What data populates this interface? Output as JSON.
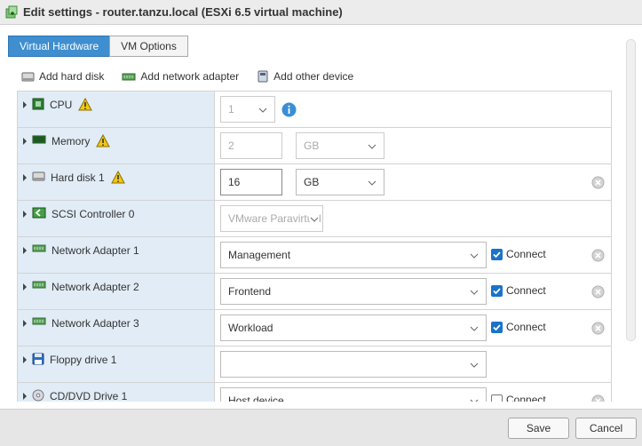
{
  "window": {
    "title": "Edit settings - router.tanzu.local (ESXi 6.5 virtual machine)",
    "icon": "vm-settings-icon"
  },
  "tabs": [
    {
      "label": "Virtual Hardware",
      "active": true
    },
    {
      "label": "VM Options",
      "active": false
    }
  ],
  "toolbar": {
    "add_hard_disk": "Add hard disk",
    "add_network_adapter": "Add network adapter",
    "add_other_device": "Add other device"
  },
  "devices": {
    "cpu": {
      "label": "CPU",
      "value": "1",
      "warning": true
    },
    "memory": {
      "label": "Memory",
      "value": "2",
      "unit": "GB",
      "warning": true
    },
    "hard_disk_1": {
      "label": "Hard disk 1",
      "value": "16",
      "unit": "GB",
      "warning": true
    },
    "scsi_controller_0": {
      "label": "SCSI Controller 0",
      "value": "VMware Paravirtual"
    },
    "network_adapter_1": {
      "label": "Network Adapter 1",
      "value": "Management",
      "connect_label": "Connect",
      "connected": true
    },
    "network_adapter_2": {
      "label": "Network Adapter 2",
      "value": "Frontend",
      "connect_label": "Connect",
      "connected": true
    },
    "network_adapter_3": {
      "label": "Network Adapter 3",
      "value": "Workload",
      "connect_label": "Connect",
      "connected": true
    },
    "floppy_drive_1": {
      "label": "Floppy drive 1",
      "value": ""
    },
    "cd_dvd_drive_1": {
      "label": "CD/DVD Drive 1",
      "value": "Host device",
      "connect_label": "Connect",
      "connected": false
    }
  },
  "footer": {
    "save_label": "Save",
    "cancel_label": "Cancel"
  },
  "colors": {
    "tab_active": "#3e8ed0",
    "label_column": "#e1ecf6",
    "checkbox": "#1a73c8",
    "warning": "#f2c811"
  }
}
